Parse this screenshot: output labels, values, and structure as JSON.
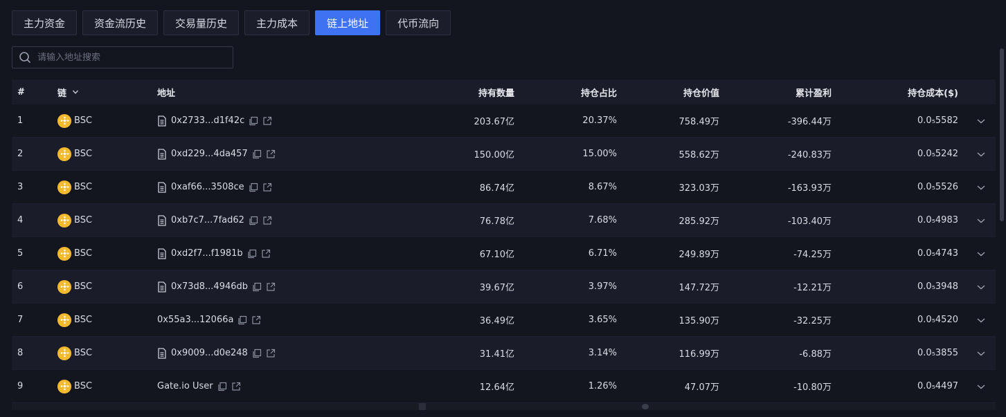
{
  "tabs": [
    {
      "label": "主力资金",
      "active": false
    },
    {
      "label": "资金流历史",
      "active": false
    },
    {
      "label": "交易量历史",
      "active": false
    },
    {
      "label": "主力成本",
      "active": false
    },
    {
      "label": "链上地址",
      "active": true
    },
    {
      "label": "代币流向",
      "active": false
    }
  ],
  "search": {
    "placeholder": "请输入地址搜索",
    "value": ""
  },
  "table": {
    "headers": {
      "index": "#",
      "chain": "链",
      "address": "地址",
      "quantity": "持有数量",
      "share": "持仓占比",
      "value": "持仓价值",
      "pnl": "累计盈利",
      "cost": "持仓成本($)"
    },
    "rows": [
      {
        "index": "1",
        "chain": "BSC",
        "address": "0x2733...d1f42c",
        "contract": true,
        "quantity": "203.67亿",
        "share": "20.37%",
        "value": "758.49万",
        "pnl": "-396.44万",
        "cost": "0.0₅5582"
      },
      {
        "index": "2",
        "chain": "BSC",
        "address": "0xd229...4da457",
        "contract": true,
        "quantity": "150.00亿",
        "share": "15.00%",
        "value": "558.62万",
        "pnl": "-240.83万",
        "cost": "0.0₅5242"
      },
      {
        "index": "3",
        "chain": "BSC",
        "address": "0xaf66...3508ce",
        "contract": true,
        "quantity": "86.74亿",
        "share": "8.67%",
        "value": "323.03万",
        "pnl": "-163.93万",
        "cost": "0.0₅5526"
      },
      {
        "index": "4",
        "chain": "BSC",
        "address": "0xb7c7...7fad62",
        "contract": true,
        "quantity": "76.78亿",
        "share": "7.68%",
        "value": "285.92万",
        "pnl": "-103.40万",
        "cost": "0.0₅4983"
      },
      {
        "index": "5",
        "chain": "BSC",
        "address": "0xd2f7...f1981b",
        "contract": true,
        "quantity": "67.10亿",
        "share": "6.71%",
        "value": "249.89万",
        "pnl": "-74.25万",
        "cost": "0.0₅4743"
      },
      {
        "index": "6",
        "chain": "BSC",
        "address": "0x73d8...4946db",
        "contract": true,
        "quantity": "39.67亿",
        "share": "3.97%",
        "value": "147.72万",
        "pnl": "-12.21万",
        "cost": "0.0₅3948"
      },
      {
        "index": "7",
        "chain": "BSC",
        "address": "0x55a3...12066a",
        "contract": false,
        "quantity": "36.49亿",
        "share": "3.65%",
        "value": "135.90万",
        "pnl": "-32.25万",
        "cost": "0.0₅4520"
      },
      {
        "index": "8",
        "chain": "BSC",
        "address": "0x9009...d0e248",
        "contract": true,
        "quantity": "31.41亿",
        "share": "3.14%",
        "value": "116.99万",
        "pnl": "-6.88万",
        "cost": "0.0₅3855"
      },
      {
        "index": "9",
        "chain": "BSC",
        "address": "Gate.io User",
        "contract": false,
        "quantity": "12.64亿",
        "share": "1.26%",
        "value": "47.07万",
        "pnl": "-10.80万",
        "cost": "0.0₅4497"
      }
    ]
  },
  "colors": {
    "accent": "#3f72f2",
    "bnb": "#f3ba2f",
    "bg": "#13151f",
    "row_alt": "#1a1d29"
  },
  "icons": {
    "search": "search-icon",
    "chain_sort": "chevron-down-icon",
    "contract": "document-icon",
    "copy": "copy-icon",
    "link": "external-link-icon",
    "expand": "chevron-down-icon",
    "chain_logo": "bnb-icon"
  }
}
